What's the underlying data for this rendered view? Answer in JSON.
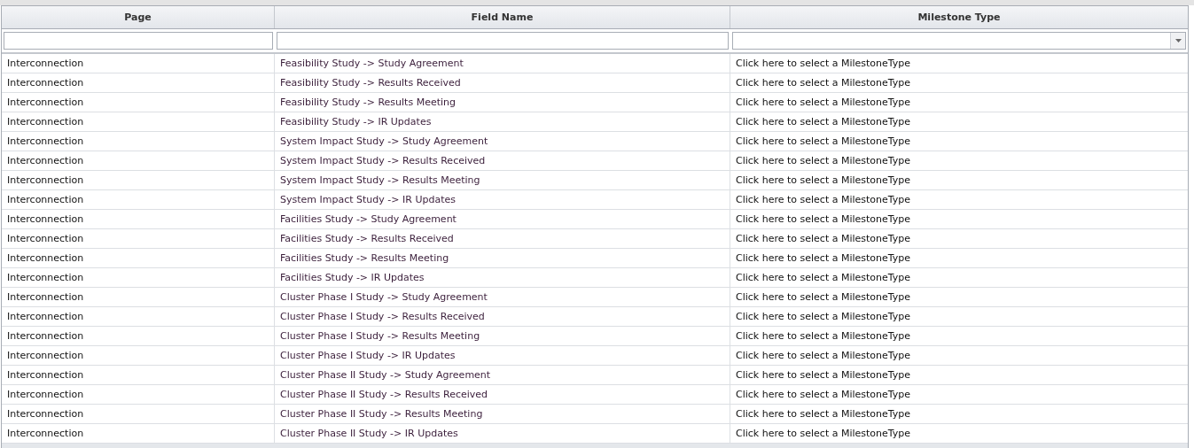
{
  "table": {
    "columns": [
      {
        "label": "Page"
      },
      {
        "label": "Field Name"
      },
      {
        "label": "Milestone Type"
      }
    ],
    "filters": [
      {
        "kind": "text"
      },
      {
        "kind": "text"
      },
      {
        "kind": "dropdown"
      }
    ],
    "rows": [
      {
        "page": "Interconnection",
        "field_name": "Feasibility Study -> Study Agreement",
        "milestone_type": "Click here to select a MilestoneType"
      },
      {
        "page": "Interconnection",
        "field_name": "Feasibility Study -> Results Received",
        "milestone_type": "Click here to select a MilestoneType"
      },
      {
        "page": "Interconnection",
        "field_name": "Feasibility Study -> Results Meeting",
        "milestone_type": "Click here to select a MilestoneType"
      },
      {
        "page": "Interconnection",
        "field_name": "Feasibility Study -> IR Updates",
        "milestone_type": "Click here to select a MilestoneType"
      },
      {
        "page": "Interconnection",
        "field_name": "System Impact Study -> Study Agreement",
        "milestone_type": "Click here to select a MilestoneType"
      },
      {
        "page": "Interconnection",
        "field_name": "System Impact Study -> Results Received",
        "milestone_type": "Click here to select a MilestoneType"
      },
      {
        "page": "Interconnection",
        "field_name": "System Impact Study -> Results Meeting",
        "milestone_type": "Click here to select a MilestoneType"
      },
      {
        "page": "Interconnection",
        "field_name": "System Impact Study -> IR Updates",
        "milestone_type": "Click here to select a MilestoneType"
      },
      {
        "page": "Interconnection",
        "field_name": "Facilities Study -> Study Agreement",
        "milestone_type": "Click here to select a MilestoneType"
      },
      {
        "page": "Interconnection",
        "field_name": "Facilities Study -> Results Received",
        "milestone_type": "Click here to select a MilestoneType"
      },
      {
        "page": "Interconnection",
        "field_name": "Facilities Study -> Results Meeting",
        "milestone_type": "Click here to select a MilestoneType"
      },
      {
        "page": "Interconnection",
        "field_name": "Facilities Study -> IR Updates",
        "milestone_type": "Click here to select a MilestoneType"
      },
      {
        "page": "Interconnection",
        "field_name": "Cluster Phase I Study -> Study Agreement",
        "milestone_type": "Click here to select a MilestoneType"
      },
      {
        "page": "Interconnection",
        "field_name": "Cluster Phase I Study -> Results Received",
        "milestone_type": "Click here to select a MilestoneType"
      },
      {
        "page": "Interconnection",
        "field_name": "Cluster Phase I Study -> Results Meeting",
        "milestone_type": "Click here to select a MilestoneType"
      },
      {
        "page": "Interconnection",
        "field_name": "Cluster Phase I Study -> IR Updates",
        "milestone_type": "Click here to select a MilestoneType"
      },
      {
        "page": "Interconnection",
        "field_name": "Cluster Phase II Study -> Study Agreement",
        "milestone_type": "Click here to select a MilestoneType"
      },
      {
        "page": "Interconnection",
        "field_name": "Cluster Phase II Study -> Results Received",
        "milestone_type": "Click here to select a MilestoneType"
      },
      {
        "page": "Interconnection",
        "field_name": "Cluster Phase II Study -> Results Meeting",
        "milestone_type": "Click here to select a MilestoneType"
      },
      {
        "page": "Interconnection",
        "field_name": "Cluster Phase II Study -> IR Updates",
        "milestone_type": "Click here to select a MilestoneType"
      }
    ]
  }
}
